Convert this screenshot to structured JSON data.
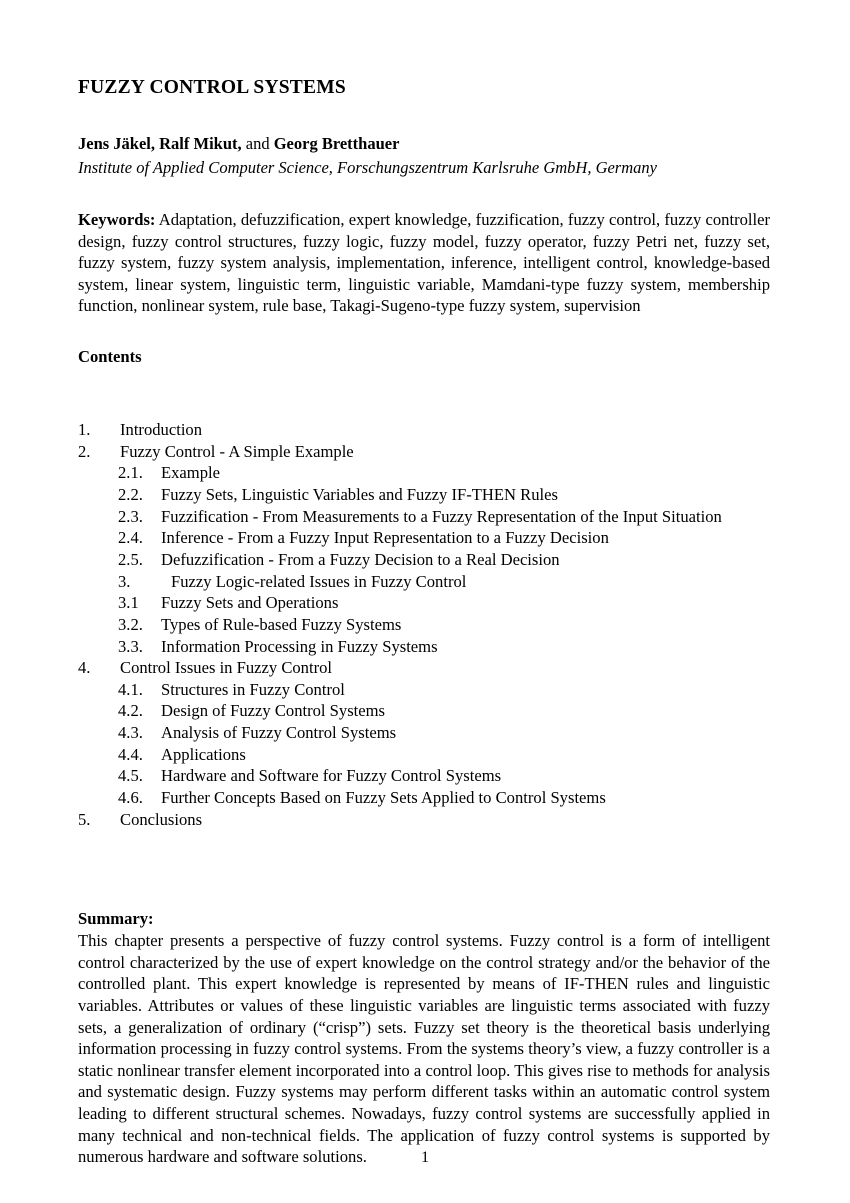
{
  "document": {
    "title": "FUZZY CONTROL SYSTEMS",
    "authors_prefix": "Jens Jäkel, Ralf Mikut,",
    "authors_conjunction": " and ",
    "authors_last": "Georg Bretthauer",
    "affiliation": "Institute of Applied Computer Science, Forschungszentrum Karlsruhe GmbH, Germany",
    "page_number": "1"
  },
  "keywords": {
    "label": "Keywords:",
    "text": " Adaptation, defuzzification, expert knowledge, fuzzification, fuzzy control, fuzzy controller design, fuzzy control structures, fuzzy logic, fuzzy model, fuzzy operator, fuzzy Petri net, fuzzy set, fuzzy system, fuzzy system analysis, implementation, inference, intelligent control, knowledge-based system, linear system, linguistic term, linguistic variable, Mamdani-type fuzzy system, membership function, nonlinear system, rule base, Takagi-Sugeno-type fuzzy system, supervision"
  },
  "contents": {
    "heading": "Contents",
    "entries": [
      {
        "number": "1.",
        "label": "Introduction",
        "level": 1
      },
      {
        "number": "2.",
        "label": "Fuzzy Control - A Simple Example",
        "level": 1
      },
      {
        "number": "2.1.",
        "label": "Example",
        "level": 2
      },
      {
        "number": "2.2.",
        "label": "Fuzzy Sets, Linguistic Variables and Fuzzy IF-THEN Rules",
        "level": 2
      },
      {
        "number": "2.3.",
        "label": "Fuzzification - From Measurements to a Fuzzy Representation of the Input Situation",
        "level": 2
      },
      {
        "number": "2.4.",
        "label": "Inference - From a Fuzzy Input Representation to a Fuzzy Decision",
        "level": 2
      },
      {
        "number": "2.5.",
        "label": "Defuzzification - From a Fuzzy Decision to a Real Decision",
        "level": 2
      },
      {
        "number": "3.",
        "label": "Fuzzy Logic-related Issues in Fuzzy Control",
        "level": 2,
        "wide": true
      },
      {
        "number": "3.1",
        "label": "Fuzzy Sets and Operations",
        "level": 2
      },
      {
        "number": "3.2.",
        "label": "Types of Rule-based Fuzzy Systems",
        "level": 2
      },
      {
        "number": "3.3.",
        "label": "Information Processing in Fuzzy Systems",
        "level": 2
      },
      {
        "number": "4.",
        "label": "Control Issues in Fuzzy Control",
        "level": 1
      },
      {
        "number": "4.1.",
        "label": "Structures in Fuzzy Control",
        "level": 2
      },
      {
        "number": "4.2.",
        "label": "Design of Fuzzy Control Systems",
        "level": 2
      },
      {
        "number": "4.3.",
        "label": "Analysis of Fuzzy Control Systems",
        "level": 2
      },
      {
        "number": "4.4.",
        "label": "Applications",
        "level": 2
      },
      {
        "number": "4.5.",
        "label": "Hardware and Software for Fuzzy Control Systems",
        "level": 2
      },
      {
        "number": "4.6.",
        "label": "Further Concepts Based on Fuzzy Sets Applied to Control Systems",
        "level": 2
      },
      {
        "number": "5.",
        "label": "Conclusions",
        "level": 1
      }
    ]
  },
  "summary": {
    "label": "Summary:",
    "text": "This chapter presents a perspective of fuzzy control systems. Fuzzy control is a form of intelligent control characterized by the use of expert knowledge on the control strategy and/or the behavior of the controlled plant. This expert knowledge is represented by means of IF-THEN rules and linguistic variables. Attributes or values of these linguistic variables are linguistic terms associated with fuzzy sets, a generalization of ordinary (“crisp”) sets. Fuzzy set theory is the theoretical basis underlying information processing in fuzzy control systems. From the systems theory’s view, a fuzzy controller is a static nonlinear transfer element incorporated into a control loop. This gives rise to methods for analysis and systematic design. Fuzzy systems may perform different tasks within an automatic control system leading to different structural schemes. Nowadays, fuzzy control systems are successfully applied in many technical and non-technical fields. The application of fuzzy control systems is supported by numerous hardware and software solutions."
  }
}
